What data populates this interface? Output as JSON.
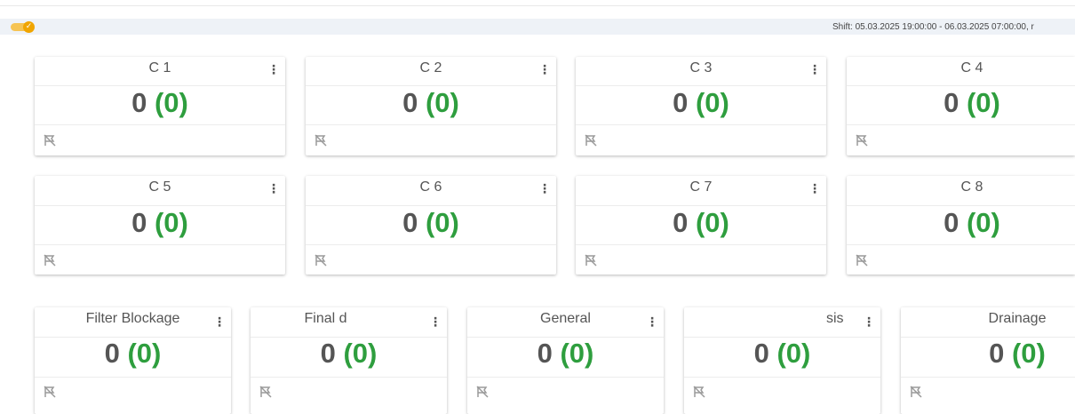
{
  "header": {
    "shift_text": "Shift: 05.03.2025 19:00:00 - 06.03.2025 07:00:00, r",
    "toggle_on": true
  },
  "colors": {
    "accent": "#f0a500",
    "value_green": "#2e9e3e",
    "value_gray": "#555555"
  },
  "icons": {
    "menu": "vertical-dots-icon",
    "flag": "flag-off-icon",
    "toggle": "check-icon"
  },
  "cards_row1": [
    {
      "title": "C   1",
      "value": "0",
      "sub": "(0)"
    },
    {
      "title": "C   2",
      "value": "0",
      "sub": "(0)"
    },
    {
      "title": "C   3",
      "value": "0",
      "sub": "(0)"
    },
    {
      "title": "C   4",
      "value": "0",
      "sub": "(0)"
    }
  ],
  "cards_row2": [
    {
      "title": "C   5",
      "value": "0",
      "sub": "(0)"
    },
    {
      "title": "C   6",
      "value": "0",
      "sub": "(0)"
    },
    {
      "title": "C   7",
      "value": "0",
      "sub": "(0)"
    },
    {
      "title": "C   8",
      "value": "0",
      "sub": "(0)"
    }
  ],
  "cards_row3": [
    {
      "title": "Filter Blockage",
      "value": "0",
      "sub": "(0)"
    },
    {
      "title": "Final d",
      "value": "0",
      "sub": "(0)"
    },
    {
      "title": "General",
      "value": "0",
      "sub": "(0)"
    },
    {
      "title": "sis",
      "value": "0",
      "sub": "(0)"
    },
    {
      "title": "Drainage",
      "value": "0",
      "sub": "(0)"
    }
  ]
}
